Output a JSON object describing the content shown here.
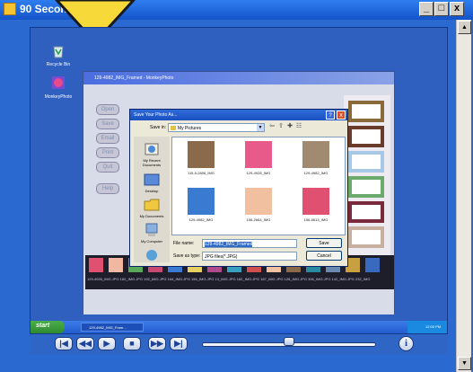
{
  "window": {
    "title": "90 Second Tutorial",
    "min_label": "_",
    "max_label": "□",
    "close_label": "x"
  },
  "desktop": {
    "icons": [
      {
        "label": "Recycle Bin",
        "icon": "recycle-bin-icon"
      },
      {
        "label": "MonkeyPhoto",
        "icon": "monkeyphoto-icon"
      }
    ]
  },
  "app": {
    "title": "129-4982_IMG_Framed - MonkeyPhoto",
    "buttons": [
      "Open",
      "Save",
      "Email",
      "Print",
      "Quit",
      "Help"
    ],
    "film_labels": "129-4926_IMG.JPG 182_IMG.JPG 192_IMG.JPG 164_IMG.JPG 156_IMG.JPG 13_IMG.JPG 162_IMG.JPG 187_IMG.JPG 128_IMG.JPG 306_IMG.JPG 142_IMG.JPG 232_IMG"
  },
  "dialog": {
    "title": "Save Your Photo As...",
    "save_in_label": "Save in:",
    "save_in_value": "My Pictures",
    "places": [
      "My Recent Documents",
      "Desktop",
      "My Documents",
      "My Computer",
      "My Network"
    ],
    "files": [
      {
        "name": "115-5-2806_IMG",
        "color": "#8a6a4a"
      },
      {
        "name": "129-4928_IMG",
        "color": "#e85a8a"
      },
      {
        "name": "129-4982_IMG",
        "color": "#a08a70"
      },
      {
        "name": "129-4982_IMG",
        "color": "#3a7ad0"
      },
      {
        "name": "156-2664_IMG",
        "color": "#f0c0a0"
      },
      {
        "name": "156-5613_IMG",
        "color": "#e05070"
      }
    ],
    "file_name_label": "File name:",
    "file_name_value": "129-4982_IMG_Framed",
    "file_type_label": "Save as type:",
    "file_type_value": "JPG files(*.JPG)",
    "save_button": "Save",
    "cancel_button": "Cancel",
    "help_label": "?",
    "close_label": "x"
  },
  "taskbar": {
    "start_label": "start",
    "task_label": "129-4982_IMG_Fram...",
    "clock": "12:00 PM"
  },
  "player": {
    "buttons": [
      {
        "name": "first-button",
        "glyph": "|◀"
      },
      {
        "name": "rewind-button",
        "glyph": "◀◀"
      },
      {
        "name": "play-button",
        "glyph": "▶"
      },
      {
        "name": "stop-button",
        "glyph": "■"
      },
      {
        "name": "forward-button",
        "glyph": "▶▶"
      },
      {
        "name": "last-button",
        "glyph": "▶|"
      }
    ],
    "progress": 0.5,
    "info_label": "i"
  },
  "scrollbar": {
    "up": "▲",
    "down": "▼"
  },
  "accent": {
    "title_bar": "#1454c8",
    "arrow_fill": "#f7d93a"
  }
}
